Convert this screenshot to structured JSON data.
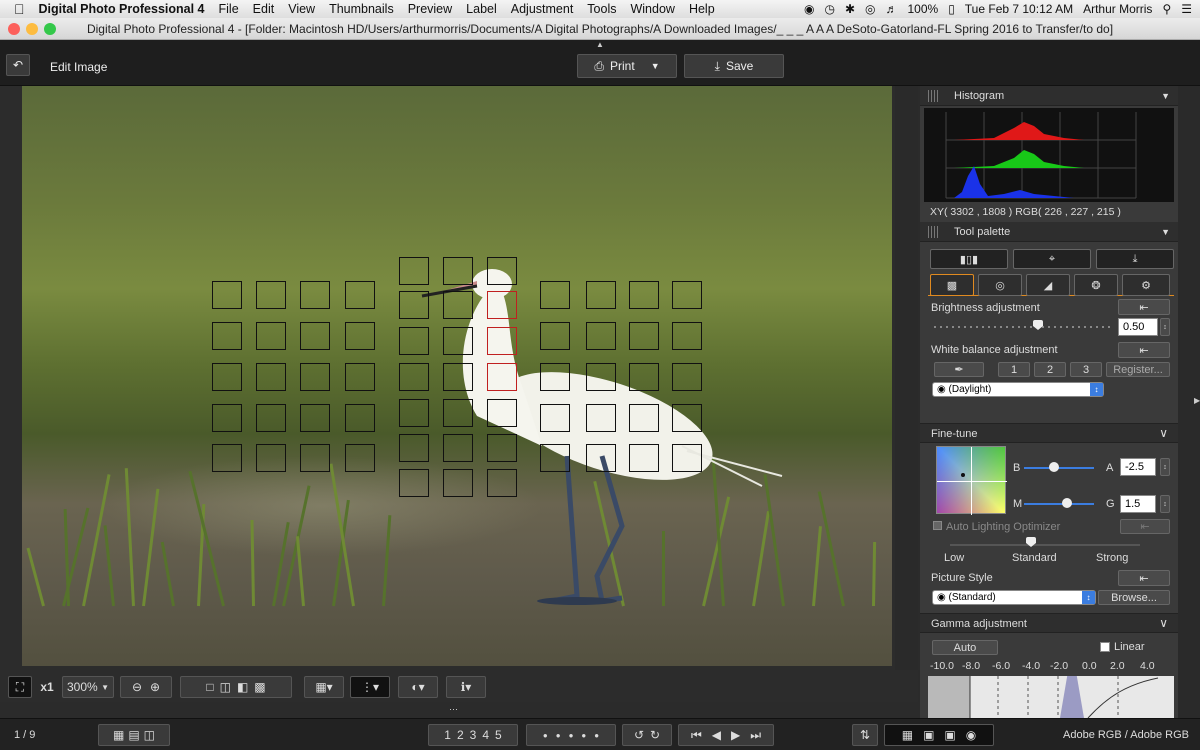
{
  "menubar": {
    "app_name": "Digital Photo Professional 4",
    "items": [
      "File",
      "Edit",
      "View",
      "Thumbnails",
      "Preview",
      "Label",
      "Adjustment",
      "Tools",
      "Window",
      "Help"
    ],
    "battery": "100%",
    "clock": "Tue Feb 7  10:12 AM",
    "user": "Arthur Morris"
  },
  "window": {
    "title": "Digital Photo Professional 4 - [Folder: Macintosh HD/Users/arthurmorris/Documents/A Digital Photographs/A Downloaded Images/_ _ _ A A A DeSoto-Gatorland-FL Spring 2016 to Transfer/to do]"
  },
  "toolbar": {
    "mode_label": "Edit Image",
    "print_label": "Print",
    "save_label": "Save"
  },
  "bottom_tools": {
    "zoom_multiplier": "x1",
    "zoom_level": "300%"
  },
  "statusbar": {
    "page": "1 / 9",
    "ratings": [
      "1",
      "2",
      "3",
      "4",
      "5"
    ],
    "color_space": "Adobe RGB / Adobe RGB"
  },
  "histogram": {
    "title": "Histogram",
    "readout": "XY(  3302 ,    1808 ) RGB( 226 ,  227 ,  215 )"
  },
  "tool_palette": {
    "title": "Tool palette",
    "brightness_label": "Brightness adjustment",
    "brightness_value": "0.50",
    "white_balance_label": "White balance adjustment",
    "wb_presets": [
      "1",
      "2",
      "3"
    ],
    "register_label": "Register...",
    "wb_selected": "(Daylight)"
  },
  "fine_tune": {
    "title": "Fine-tune",
    "b_label": "B",
    "a_label": "A",
    "a_value": "-2.5",
    "m_label": "M",
    "g_label": "G",
    "g_value": "1.5",
    "alo_label": "Auto Lighting Optimizer",
    "alo_levels": [
      "Low",
      "Standard",
      "Strong"
    ],
    "picture_style_label": "Picture Style",
    "picture_style_selected": "(Standard)",
    "browse_label": "Browse..."
  },
  "gamma": {
    "title": "Gamma adjustment",
    "auto_label": "Auto",
    "linear_label": "Linear",
    "scale": [
      "-10.0",
      "-8.0",
      "-6.0",
      "-4.0",
      "-2.0",
      "0.0",
      "2.0",
      "4.0"
    ]
  }
}
